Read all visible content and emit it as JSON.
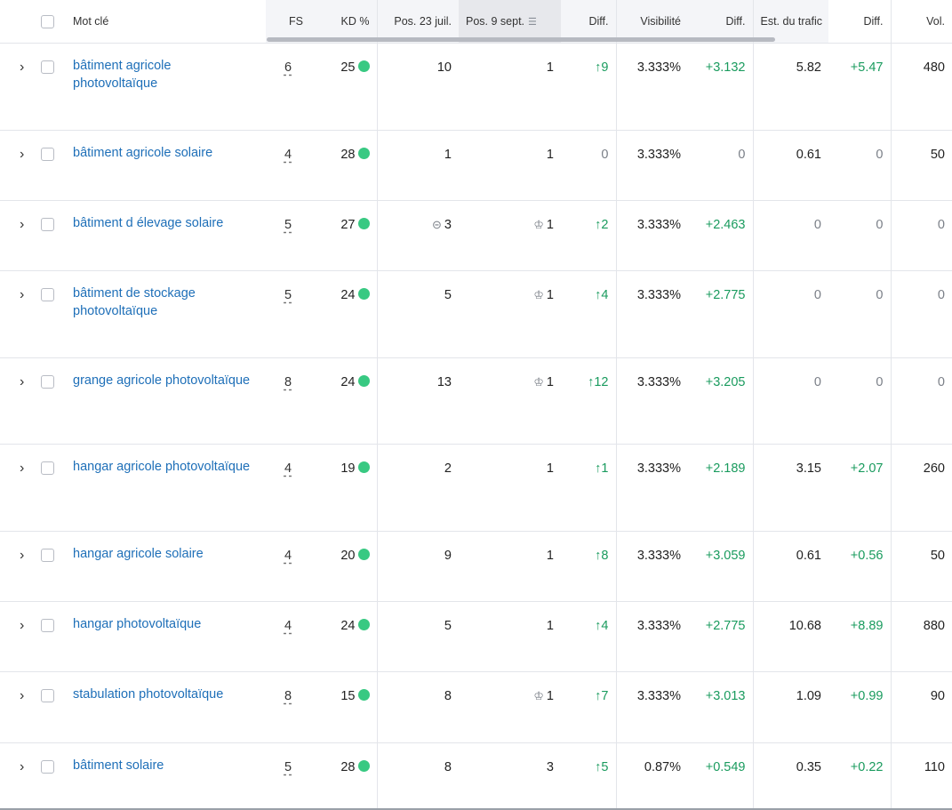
{
  "columns": {
    "keyword": "Mot clé",
    "fs": "FS",
    "kd": "KD %",
    "pos1": "Pos. 23 juil.",
    "pos2": "Pos. 9 sept.",
    "diff1": "Diff.",
    "visibility": "Visibilité",
    "diff2": "Diff.",
    "traffic": "Est. du trafic",
    "diff3": "Diff.",
    "vol": "Vol."
  },
  "icons": {
    "expand": "chevron-right-icon",
    "link": "link-icon",
    "crown": "crown-icon",
    "sort": "sort-descending-icon",
    "kd_dot": "kd-dot",
    "up_arrow": "arrow-up-icon"
  },
  "colors": {
    "link": "#1e6fb8",
    "positive": "#1a9b5e",
    "kd_dot": "#38c982",
    "muted": "#7a7f87"
  },
  "rows": [
    {
      "keyword": "bâtiment agricole photovoltaïque",
      "fs": "6",
      "kd": "25",
      "pos1": "10",
      "pos1_icon": "",
      "pos2": "1",
      "pos2_icon": "",
      "diff1": "↑9",
      "visibility": "3.333%",
      "diff2": "+3.132",
      "traffic": "5.82",
      "diff3": "+5.47",
      "vol": "480",
      "height": 98
    },
    {
      "keyword": "bâtiment agricole solaire",
      "fs": "4",
      "kd": "28",
      "pos1": "1",
      "pos1_icon": "",
      "pos2": "1",
      "pos2_icon": "",
      "diff1": "0",
      "visibility": "3.333%",
      "diff2": "0",
      "traffic": "0.61",
      "diff3": "0",
      "vol": "50",
      "height": 79
    },
    {
      "keyword": "bâtiment d élevage solaire",
      "fs": "5",
      "kd": "27",
      "pos1": "3",
      "pos1_icon": "link",
      "pos2": "1",
      "pos2_icon": "crown",
      "diff1": "↑2",
      "visibility": "3.333%",
      "diff2": "+2.463",
      "traffic": "0",
      "diff3": "0",
      "vol": "0",
      "height": 79
    },
    {
      "keyword": "bâtiment de stockage photovoltaïque",
      "fs": "5",
      "kd": "24",
      "pos1": "5",
      "pos1_icon": "",
      "pos2": "1",
      "pos2_icon": "crown",
      "diff1": "↑4",
      "visibility": "3.333%",
      "diff2": "+2.775",
      "traffic": "0",
      "diff3": "0",
      "vol": "0",
      "height": 98
    },
    {
      "keyword": "grange agricole photovoltaïque",
      "fs": "8",
      "kd": "24",
      "pos1": "13",
      "pos1_icon": "",
      "pos2": "1",
      "pos2_icon": "crown",
      "diff1": "↑12",
      "visibility": "3.333%",
      "diff2": "+3.205",
      "traffic": "0",
      "diff3": "0",
      "vol": "0",
      "height": 97
    },
    {
      "keyword": "hangar agricole photovoltaïque",
      "fs": "4",
      "kd": "19",
      "pos1": "2",
      "pos1_icon": "",
      "pos2": "1",
      "pos2_icon": "",
      "diff1": "↑1",
      "visibility": "3.333%",
      "diff2": "+2.189",
      "traffic": "3.15",
      "diff3": "+2.07",
      "vol": "260",
      "height": 98
    },
    {
      "keyword": "hangar agricole solaire",
      "fs": "4",
      "kd": "20",
      "pos1": "9",
      "pos1_icon": "",
      "pos2": "1",
      "pos2_icon": "",
      "diff1": "↑8",
      "visibility": "3.333%",
      "diff2": "+3.059",
      "traffic": "0.61",
      "diff3": "+0.56",
      "vol": "50",
      "height": 79
    },
    {
      "keyword": "hangar photovoltaïque",
      "fs": "4",
      "kd": "24",
      "pos1": "5",
      "pos1_icon": "",
      "pos2": "1",
      "pos2_icon": "",
      "diff1": "↑4",
      "visibility": "3.333%",
      "diff2": "+2.775",
      "traffic": "10.68",
      "diff3": "+8.89",
      "vol": "880",
      "height": 79
    },
    {
      "keyword": "stabulation photovoltaïque",
      "fs": "8",
      "kd": "15",
      "pos1": "8",
      "pos1_icon": "",
      "pos2": "1",
      "pos2_icon": "crown",
      "diff1": "↑7",
      "visibility": "3.333%",
      "diff2": "+3.013",
      "traffic": "1.09",
      "diff3": "+0.99",
      "vol": "90",
      "height": 80
    },
    {
      "keyword": "bâtiment solaire",
      "fs": "5",
      "kd": "28",
      "pos1": "8",
      "pos1_icon": "",
      "pos2": "3",
      "pos2_icon": "",
      "diff1": "↑5",
      "visibility": "0.87%",
      "diff2": "+0.549",
      "traffic": "0.35",
      "diff3": "+0.22",
      "vol": "110",
      "height": 74
    }
  ]
}
